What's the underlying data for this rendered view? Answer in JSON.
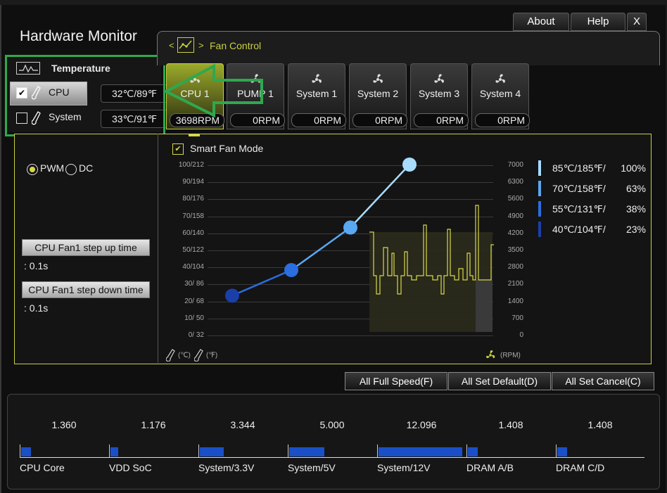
{
  "window": {
    "title": "Hardware Monitor",
    "buttons": {
      "about": "About",
      "help": "Help",
      "close": "X"
    }
  },
  "temperature": {
    "header": "Temperature",
    "rows": [
      {
        "label": "CPU",
        "value": "32℃/89℉",
        "checked": true,
        "check_mark": "✔"
      },
      {
        "label": "System",
        "value": "33℃/91℉",
        "checked": false,
        "check_mark": ""
      }
    ]
  },
  "fan_control": {
    "title": "Fan Control",
    "nav_prev": "<",
    "nav_next": ">",
    "tabs": [
      {
        "name": "CPU 1",
        "rpm": "3698RPM",
        "active": true
      },
      {
        "name": "PUMP 1",
        "rpm": "0RPM",
        "active": false
      },
      {
        "name": "System 1",
        "rpm": "0RPM",
        "active": false
      },
      {
        "name": "System 2",
        "rpm": "0RPM",
        "active": false
      },
      {
        "name": "System 3",
        "rpm": "0RPM",
        "active": false
      },
      {
        "name": "System 4",
        "rpm": "0RPM",
        "active": false
      }
    ]
  },
  "mode": {
    "pwm": "PWM",
    "dc": "DC",
    "selected": "PWM"
  },
  "step_up": {
    "label": "CPU Fan1 step up time",
    "value": ": 0.1s"
  },
  "step_down": {
    "label": "CPU Fan1 step down time",
    "value": ": 0.1s"
  },
  "smart_fan": {
    "label": "Smart Fan Mode",
    "checked": true,
    "check_mark": "✔"
  },
  "chart_data": {
    "type": "line",
    "left_ticks": [
      "100/212",
      "90/194",
      "80/176",
      "70/158",
      "60/140",
      "50/122",
      "40/104",
      "30/  86",
      "20/  68",
      "10/  50",
      "0/  32"
    ],
    "right_ticks": [
      "7000",
      "6300",
      "5600",
      "4900",
      "4200",
      "3500",
      "2800",
      "2100",
      "1400",
      "700",
      "0"
    ],
    "xlabel_c": "(℃)",
    "xlabel_f": "(℉)",
    "ylabel_right": "(RPM)",
    "curve_points": [
      {
        "temp_c": 40,
        "fan_pct": 23
      },
      {
        "temp_c": 55,
        "fan_pct": 38
      },
      {
        "temp_c": 70,
        "fan_pct": 63
      },
      {
        "temp_c": 85,
        "fan_pct": 100
      }
    ],
    "legend": [
      {
        "temp": "85℃/185℉/",
        "pct": "100%",
        "color": "#a8dcff"
      },
      {
        "temp": "70℃/158℉/",
        "pct": "63%",
        "color": "#5aa8f0"
      },
      {
        "temp": "55℃/131℉/",
        "pct": "38%",
        "color": "#2a6ee0"
      },
      {
        "temp": "40℃/104℉/",
        "pct": "23%",
        "color": "#1a3fa8"
      }
    ],
    "history_line_color": "#d8d84a"
  },
  "bottom_buttons": {
    "full_speed": "All Full Speed(F)",
    "set_default": "All Set Default(D)",
    "set_cancel": "All Set Cancel(C)"
  },
  "voltages": [
    {
      "label": "CPU Core",
      "value": "1.360",
      "fill": 0.11
    },
    {
      "label": "VDD SoC",
      "value": "1.176",
      "fill": 0.09
    },
    {
      "label": "System/3.3V",
      "value": "3.344",
      "fill": 0.27
    },
    {
      "label": "System/5V",
      "value": "5.000",
      "fill": 0.4
    },
    {
      "label": "System/12V",
      "value": "12.096",
      "fill": 0.95
    },
    {
      "label": "DRAM A/B",
      "value": "1.408",
      "fill": 0.11
    },
    {
      "label": "DRAM C/D",
      "value": "1.408",
      "fill": 0.11
    }
  ]
}
